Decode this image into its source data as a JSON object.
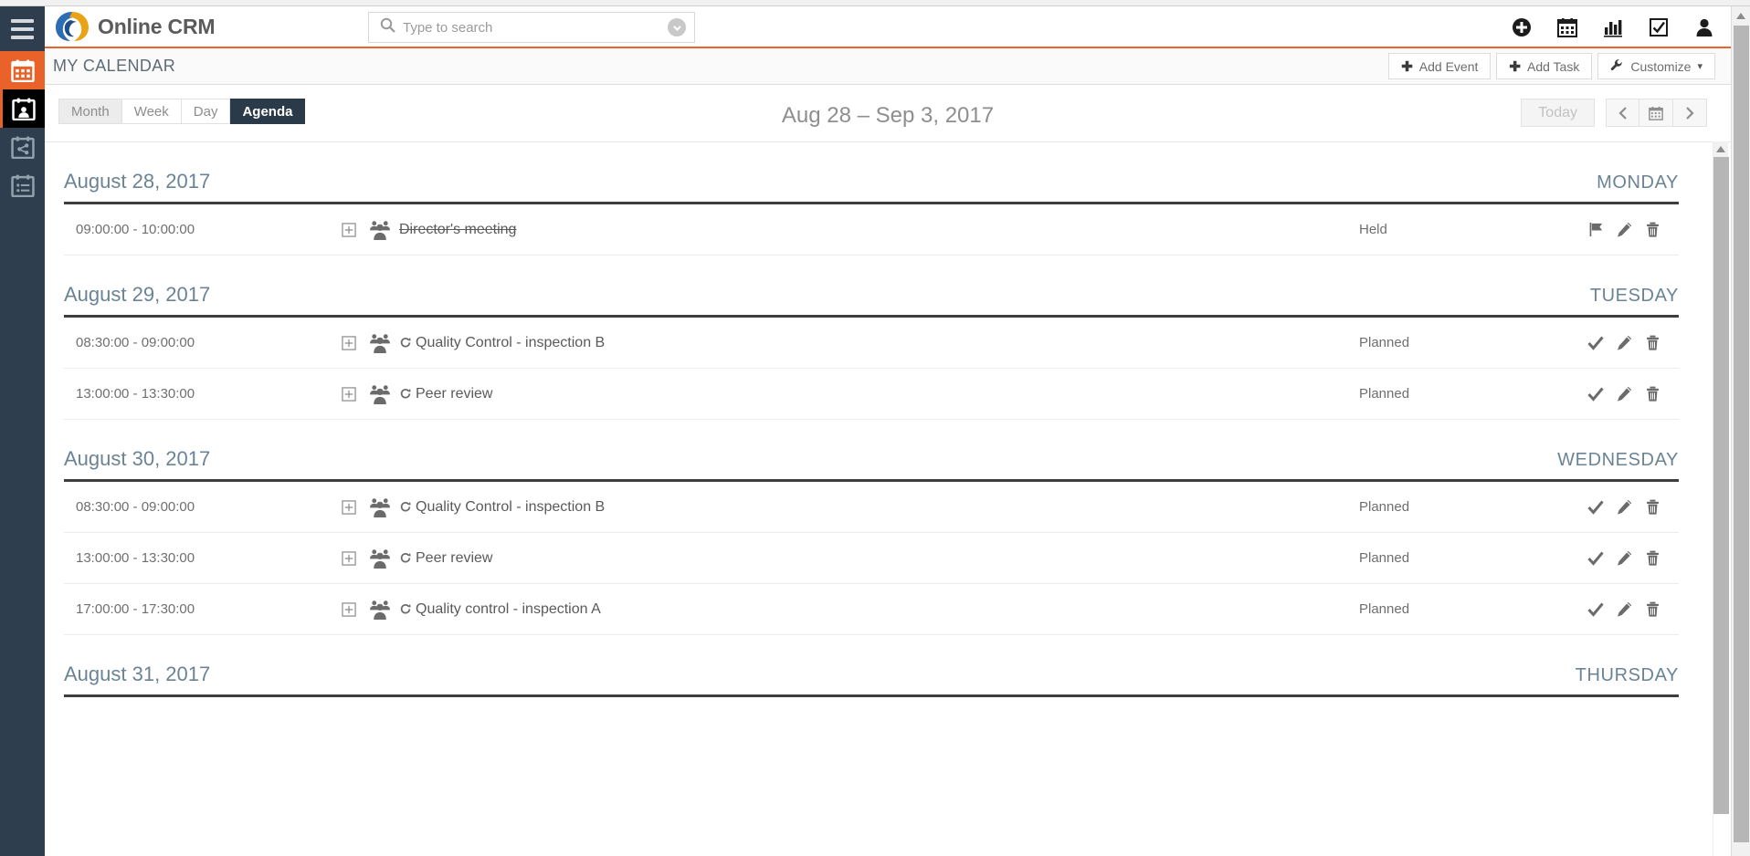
{
  "app": {
    "brand_name": "Online CRM",
    "accent_color": "#e8622a",
    "rail_color": "#2f3e4e"
  },
  "search": {
    "placeholder": "Type to search",
    "value": "",
    "icon": "search-icon",
    "dropdown_icon": "chevron-down-circle-icon"
  },
  "header_icons": [
    {
      "name": "add-circle-icon",
      "label": "Add"
    },
    {
      "name": "calendar-icon",
      "label": "Calendar"
    },
    {
      "name": "chart-bar-icon",
      "label": "Reports"
    },
    {
      "name": "checkbox-icon",
      "label": "Tasks"
    },
    {
      "name": "user-icon",
      "label": "User"
    }
  ],
  "sidebar": {
    "hamburger_label": "Menu",
    "items": [
      {
        "name": "sidebar-item-calendar",
        "icon": "calendar-icon",
        "state": "active"
      },
      {
        "name": "sidebar-item-my-calendar",
        "icon": "calendar-user-icon",
        "state": "current"
      },
      {
        "name": "sidebar-item-shared-calendar",
        "icon": "calendar-share-icon",
        "state": "normal"
      },
      {
        "name": "sidebar-item-activity-list",
        "icon": "calendar-list-icon",
        "state": "normal"
      }
    ]
  },
  "titlebar": {
    "title": "MY CALENDAR",
    "buttons": [
      {
        "name": "add-event-button",
        "label": "Add Event",
        "icon": "plus-icon"
      },
      {
        "name": "add-task-button",
        "label": "Add Task",
        "icon": "plus-icon"
      },
      {
        "name": "customize-button",
        "label": "Customize",
        "icon": "wrench-icon",
        "caret": "▾"
      }
    ]
  },
  "toolbar": {
    "views": [
      {
        "label": "Month",
        "active": false
      },
      {
        "label": "Week",
        "active": false
      },
      {
        "label": "Day",
        "active": false
      },
      {
        "label": "Agenda",
        "active": true
      }
    ],
    "range_title": "Aug 28 – Sep 3, 2017",
    "today_label": "Today",
    "prev_label": "‹",
    "next_label": "›",
    "datepicker_icon": "calendar-icon"
  },
  "agenda": {
    "days": [
      {
        "date": "August 28, 2017",
        "weekday": "MONDAY",
        "events": [
          {
            "time": "09:00:00 - 10:00:00",
            "title": "Director's meeting",
            "struck": true,
            "recurring": false,
            "status": "Held",
            "actions": [
              "flag-icon",
              "pencil-icon",
              "trash-icon"
            ]
          }
        ]
      },
      {
        "date": "August 29, 2017",
        "weekday": "TUESDAY",
        "events": [
          {
            "time": "08:30:00 - 09:00:00",
            "title": "Quality Control - inspection B",
            "struck": false,
            "recurring": true,
            "status": "Planned",
            "actions": [
              "check-icon",
              "pencil-icon",
              "trash-icon"
            ]
          },
          {
            "time": "13:00:00 - 13:30:00",
            "title": "Peer review",
            "struck": false,
            "recurring": true,
            "status": "Planned",
            "actions": [
              "check-icon",
              "pencil-icon",
              "trash-icon"
            ]
          }
        ]
      },
      {
        "date": "August 30, 2017",
        "weekday": "WEDNESDAY",
        "events": [
          {
            "time": "08:30:00 - 09:00:00",
            "title": "Quality Control - inspection B",
            "struck": false,
            "recurring": true,
            "status": "Planned",
            "actions": [
              "check-icon",
              "pencil-icon",
              "trash-icon"
            ]
          },
          {
            "time": "13:00:00 - 13:30:00",
            "title": "Peer review",
            "struck": false,
            "recurring": true,
            "status": "Planned",
            "actions": [
              "check-icon",
              "pencil-icon",
              "trash-icon"
            ]
          },
          {
            "time": "17:00:00 - 17:30:00",
            "title": "Quality control - inspection A",
            "struck": false,
            "recurring": true,
            "status": "Planned",
            "actions": [
              "check-icon",
              "pencil-icon",
              "trash-icon"
            ]
          }
        ]
      },
      {
        "date": "August 31, 2017",
        "weekday": "THURSDAY",
        "events": []
      }
    ]
  }
}
